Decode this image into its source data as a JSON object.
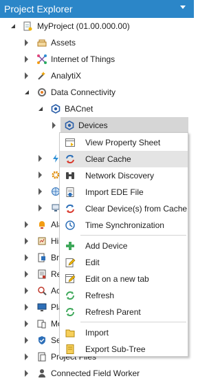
{
  "panel": {
    "title": "Project Explorer"
  },
  "tree": {
    "root": {
      "label": "MyProject (01.00.000.00)"
    },
    "assets": {
      "label": "Assets"
    },
    "iot": {
      "label": "Internet of Things"
    },
    "analytix": {
      "label": "AnalytiX"
    },
    "data_connectivity": {
      "label": "Data Connectivity"
    },
    "bacnet": {
      "label": "BACnet"
    },
    "devices": {
      "label": "Devices"
    },
    "alarms_partial": {
      "label": "Ala"
    },
    "historian_partial": {
      "label": "His"
    },
    "bridging_partial": {
      "label": "Bri"
    },
    "reports_partial": {
      "label": "Re"
    },
    "access_partial": {
      "label": "Ac"
    },
    "platform_partial": {
      "label": "Pla"
    },
    "mobile_partial": {
      "label": "Mo"
    },
    "security_partial": {
      "label": "Sec"
    },
    "project_files": {
      "label": "Project Files"
    },
    "connected_field_worker": {
      "label": "Connected Field Worker"
    }
  },
  "context_menu": {
    "view_property_sheet": "View Property Sheet",
    "clear_cache": "Clear Cache",
    "network_discovery": "Network Discovery",
    "import_ede_file": "Import EDE File",
    "clear_devices_from_cache": "Clear Device(s) from Cache",
    "time_synchronization": "Time Synchronization",
    "add_device": "Add Device",
    "edit": "Edit",
    "edit_on_new_tab": "Edit on a new tab",
    "refresh": "Refresh",
    "refresh_parent": "Refresh Parent",
    "import": "Import",
    "export_sub_tree": "Export Sub-Tree"
  },
  "colors": {
    "title_bar": "#2b86c8",
    "selection": "#d6d6d6",
    "menu_highlight": "#e4e4e4"
  }
}
